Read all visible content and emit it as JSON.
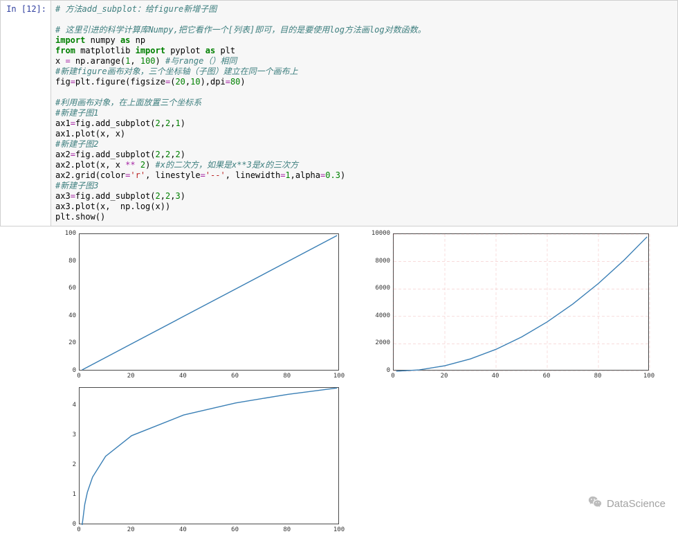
{
  "prompt": "In  [12]:",
  "code_lines": [
    [
      {
        "t": "# 方法add_subplot：给figure新增子图",
        "c": "c-italic"
      }
    ],
    [],
    [
      {
        "t": "# 这里引进的科学计算库Numpy,把它看作一个[列表]即可，目的是要使用log方法画log对数函数。",
        "c": "c-italic"
      }
    ],
    [
      {
        "t": "import",
        "c": "kw"
      },
      {
        "t": " numpy "
      },
      {
        "t": "as",
        "c": "kw"
      },
      {
        "t": " np"
      }
    ],
    [
      {
        "t": "from",
        "c": "kw"
      },
      {
        "t": " matplotlib "
      },
      {
        "t": "import",
        "c": "kw"
      },
      {
        "t": " pyplot "
      },
      {
        "t": "as",
        "c": "kw"
      },
      {
        "t": " plt"
      }
    ],
    [
      {
        "t": "x "
      },
      {
        "t": "=",
        "c": "op"
      },
      {
        "t": " np.arange("
      },
      {
        "t": "1",
        "c": "num"
      },
      {
        "t": ", "
      },
      {
        "t": "100",
        "c": "num"
      },
      {
        "t": ") "
      },
      {
        "t": "#与range（）相同",
        "c": "c-italic"
      }
    ],
    [
      {
        "t": "#新建figure画布对象，三个坐标轴（子图）建立在同一个画布上",
        "c": "c-italic"
      }
    ],
    [
      {
        "t": "fig"
      },
      {
        "t": "=",
        "c": "op"
      },
      {
        "t": "plt.figure(figsize"
      },
      {
        "t": "=",
        "c": "op"
      },
      {
        "t": "("
      },
      {
        "t": "20",
        "c": "num"
      },
      {
        "t": ","
      },
      {
        "t": "10",
        "c": "num"
      },
      {
        "t": "),dpi"
      },
      {
        "t": "=",
        "c": "op"
      },
      {
        "t": "80",
        "c": "num"
      },
      {
        "t": ")"
      }
    ],
    [],
    [
      {
        "t": "#利用画布对象，在上面放置三个坐标系",
        "c": "c-italic"
      }
    ],
    [
      {
        "t": "#新建子图1",
        "c": "c-italic"
      }
    ],
    [
      {
        "t": "ax1"
      },
      {
        "t": "=",
        "c": "op"
      },
      {
        "t": "fig.add_subplot("
      },
      {
        "t": "2",
        "c": "num"
      },
      {
        "t": ","
      },
      {
        "t": "2",
        "c": "num"
      },
      {
        "t": ","
      },
      {
        "t": "1",
        "c": "num"
      },
      {
        "t": ")"
      }
    ],
    [
      {
        "t": "ax1.plot(x, x)"
      }
    ],
    [
      {
        "t": "#新建子图2",
        "c": "c-italic"
      }
    ],
    [
      {
        "t": "ax2"
      },
      {
        "t": "=",
        "c": "op"
      },
      {
        "t": "fig.add_subplot("
      },
      {
        "t": "2",
        "c": "num"
      },
      {
        "t": ","
      },
      {
        "t": "2",
        "c": "num"
      },
      {
        "t": ","
      },
      {
        "t": "2",
        "c": "num"
      },
      {
        "t": ")"
      }
    ],
    [
      {
        "t": "ax2.plot(x, x "
      },
      {
        "t": "**",
        "c": "op"
      },
      {
        "t": " "
      },
      {
        "t": "2",
        "c": "num"
      },
      {
        "t": ") "
      },
      {
        "t": "#x的二次方，如果是x**3是x的三次方",
        "c": "c-italic"
      }
    ],
    [
      {
        "t": "ax2.grid(color"
      },
      {
        "t": "=",
        "c": "op"
      },
      {
        "t": "'r'",
        "c": "str"
      },
      {
        "t": ", linestyle"
      },
      {
        "t": "=",
        "c": "op"
      },
      {
        "t": "'--'",
        "c": "str"
      },
      {
        "t": ", linewidth"
      },
      {
        "t": "=",
        "c": "op"
      },
      {
        "t": "1",
        "c": "num"
      },
      {
        "t": ",alpha"
      },
      {
        "t": "=",
        "c": "op"
      },
      {
        "t": "0.3",
        "c": "num"
      },
      {
        "t": ")"
      }
    ],
    [
      {
        "t": "#新建子图3",
        "c": "c-italic"
      }
    ],
    [
      {
        "t": "ax3"
      },
      {
        "t": "=",
        "c": "op"
      },
      {
        "t": "fig.add_subplot("
      },
      {
        "t": "2",
        "c": "num"
      },
      {
        "t": ","
      },
      {
        "t": "2",
        "c": "num"
      },
      {
        "t": ","
      },
      {
        "t": "3",
        "c": "num"
      },
      {
        "t": ")"
      }
    ],
    [
      {
        "t": "ax3.plot(x,  np.log(x))"
      }
    ],
    [
      {
        "t": "plt.show()"
      }
    ]
  ],
  "chart_data": [
    {
      "type": "line",
      "title": "",
      "xlabel": "",
      "ylabel": "",
      "x": [
        1,
        20,
        40,
        60,
        80,
        99
      ],
      "y": [
        1,
        20,
        40,
        60,
        80,
        99
      ],
      "xlim": [
        0,
        100
      ],
      "ylim": [
        0,
        100
      ],
      "xticks": [
        0,
        20,
        40,
        60,
        80,
        100
      ],
      "yticks": [
        0,
        20,
        40,
        60,
        80,
        100
      ],
      "grid": false
    },
    {
      "type": "line",
      "title": "",
      "xlabel": "",
      "ylabel": "",
      "x": [
        1,
        10,
        20,
        30,
        40,
        50,
        60,
        70,
        80,
        90,
        99
      ],
      "y": [
        1,
        100,
        400,
        900,
        1600,
        2500,
        3600,
        4900,
        6400,
        8100,
        9801
      ],
      "xlim": [
        0,
        100
      ],
      "ylim": [
        0,
        10000
      ],
      "xticks": [
        0,
        20,
        40,
        60,
        80,
        100
      ],
      "yticks": [
        0,
        2000,
        4000,
        6000,
        8000,
        10000
      ],
      "grid": true,
      "grid_color": "#e07070",
      "grid_style": "dashed"
    },
    {
      "type": "line",
      "title": "",
      "xlabel": "",
      "ylabel": "",
      "x": [
        1,
        2,
        3,
        5,
        10,
        20,
        40,
        60,
        80,
        99
      ],
      "y": [
        0,
        0.693,
        1.099,
        1.609,
        2.303,
        2.996,
        3.689,
        4.094,
        4.382,
        4.595
      ],
      "xlim": [
        0,
        100
      ],
      "ylim": [
        0,
        4.6
      ],
      "xticks": [
        0,
        20,
        40,
        60,
        80,
        100
      ],
      "yticks": [
        0,
        1,
        2,
        3,
        4
      ],
      "grid": false
    }
  ],
  "watermark": "DataScience",
  "colors": {
    "line": "#3a7fb5",
    "axis": "#4a4a4a"
  }
}
